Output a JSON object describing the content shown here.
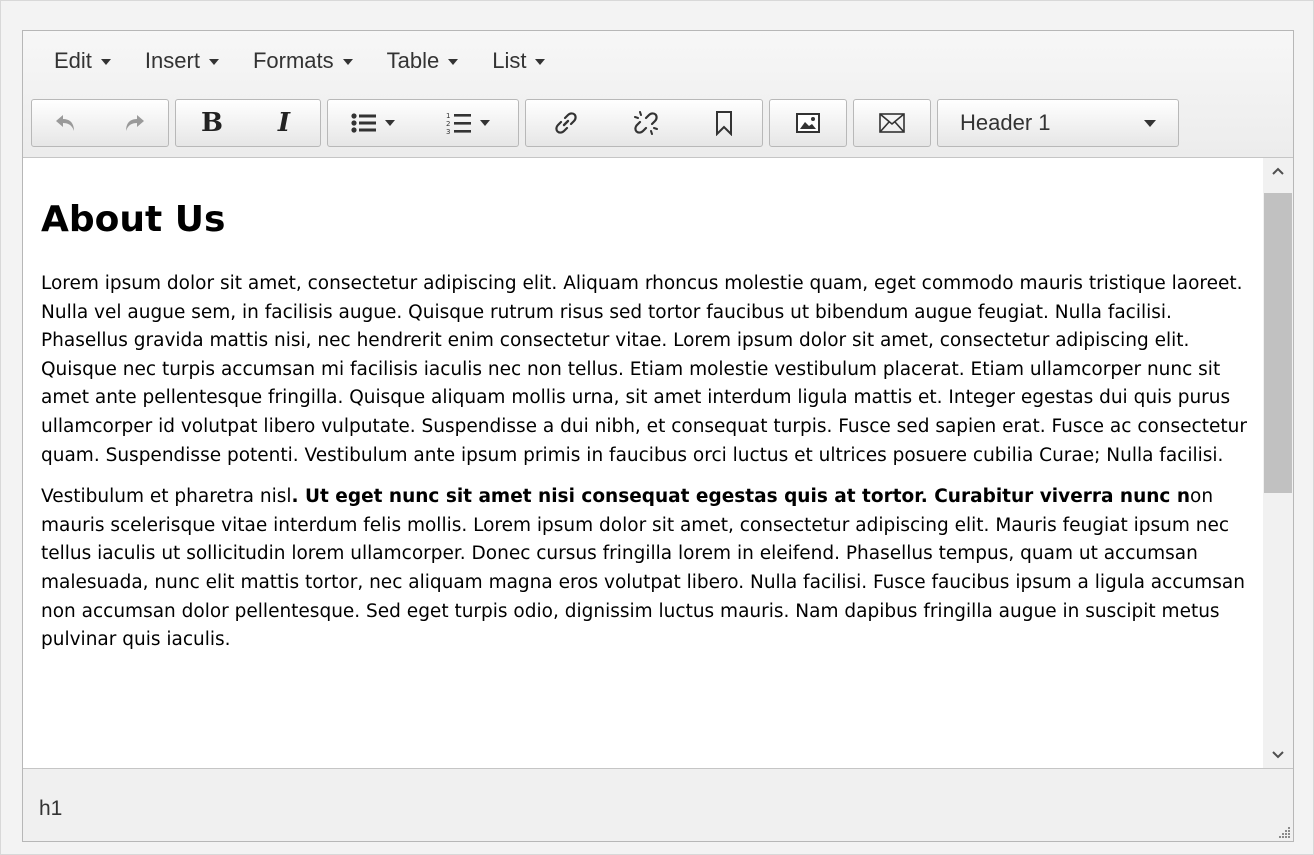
{
  "menubar": {
    "items": [
      "Edit",
      "Insert",
      "Formats",
      "Table",
      "List"
    ]
  },
  "toolbar": {
    "buttons": [
      "undo-icon",
      "redo-icon",
      "bold-icon",
      "italic-icon",
      "bullet-list-icon",
      "numbered-list-icon",
      "link-icon",
      "unlink-icon",
      "bookmark-icon",
      "image-icon",
      "email-icon"
    ],
    "bold_label": "B",
    "italic_label": "I",
    "format_select": "Header 1"
  },
  "content": {
    "heading": "About Us",
    "paragraph1": "Lorem ipsum dolor sit amet, consectetur adipiscing elit. Aliquam rhoncus molestie quam, eget commodo mauris tristique laoreet. Nulla vel augue sem, in facilisis augue. Quisque rutrum risus sed tortor faucibus ut bibendum augue feugiat. Nulla facilisi. Phasellus gravida mattis nisi, nec hendrerit enim consectetur vitae. Lorem ipsum dolor sit amet, consectetur adipiscing elit. Quisque nec turpis accumsan mi facilisis iaculis nec non tellus. Etiam molestie vestibulum placerat. Etiam ullamcorper nunc sit amet ante pellentesque fringilla. Quisque aliquam mollis urna, sit amet interdum ligula mattis et. Integer egestas dui quis purus ullamcorper id volutpat libero vulputate. Suspendisse a dui nibh, et consequat turpis. Fusce sed sapien erat. Fusce ac consectetur quam. Suspendisse potenti. Vestibulum ante ipsum primis in faucibus orci luctus et ultrices posuere cubilia Curae; Nulla facilisi.",
    "paragraph2_start": "Vestibulum et pharetra nisl",
    "paragraph2_bold": ". Ut eget nunc sit amet nisi consequat egestas quis at tortor. Curabitur viverra nunc n",
    "paragraph2_rest": "on mauris scelerisque vitae interdum felis mollis. Lorem ipsum dolor sit amet, consectetur adipiscing elit. Mauris feugiat ipsum nec tellus iaculis ut sollicitudin lorem ullamcorper. Donec cursus fringilla lorem in eleifend. Phasellus tempus, quam ut accumsan malesuada, nunc elit mattis tortor, nec aliquam magna eros volutpat libero. Nulla facilisi. Fusce faucibus ipsum a ligula accumsan non accumsan dolor pellentesque. Sed eget turpis odio, dignissim luctus mauris. Nam dapibus fringilla augue in suscipit metus pulvinar quis iaculis."
  },
  "statusbar": {
    "path": "h1"
  }
}
